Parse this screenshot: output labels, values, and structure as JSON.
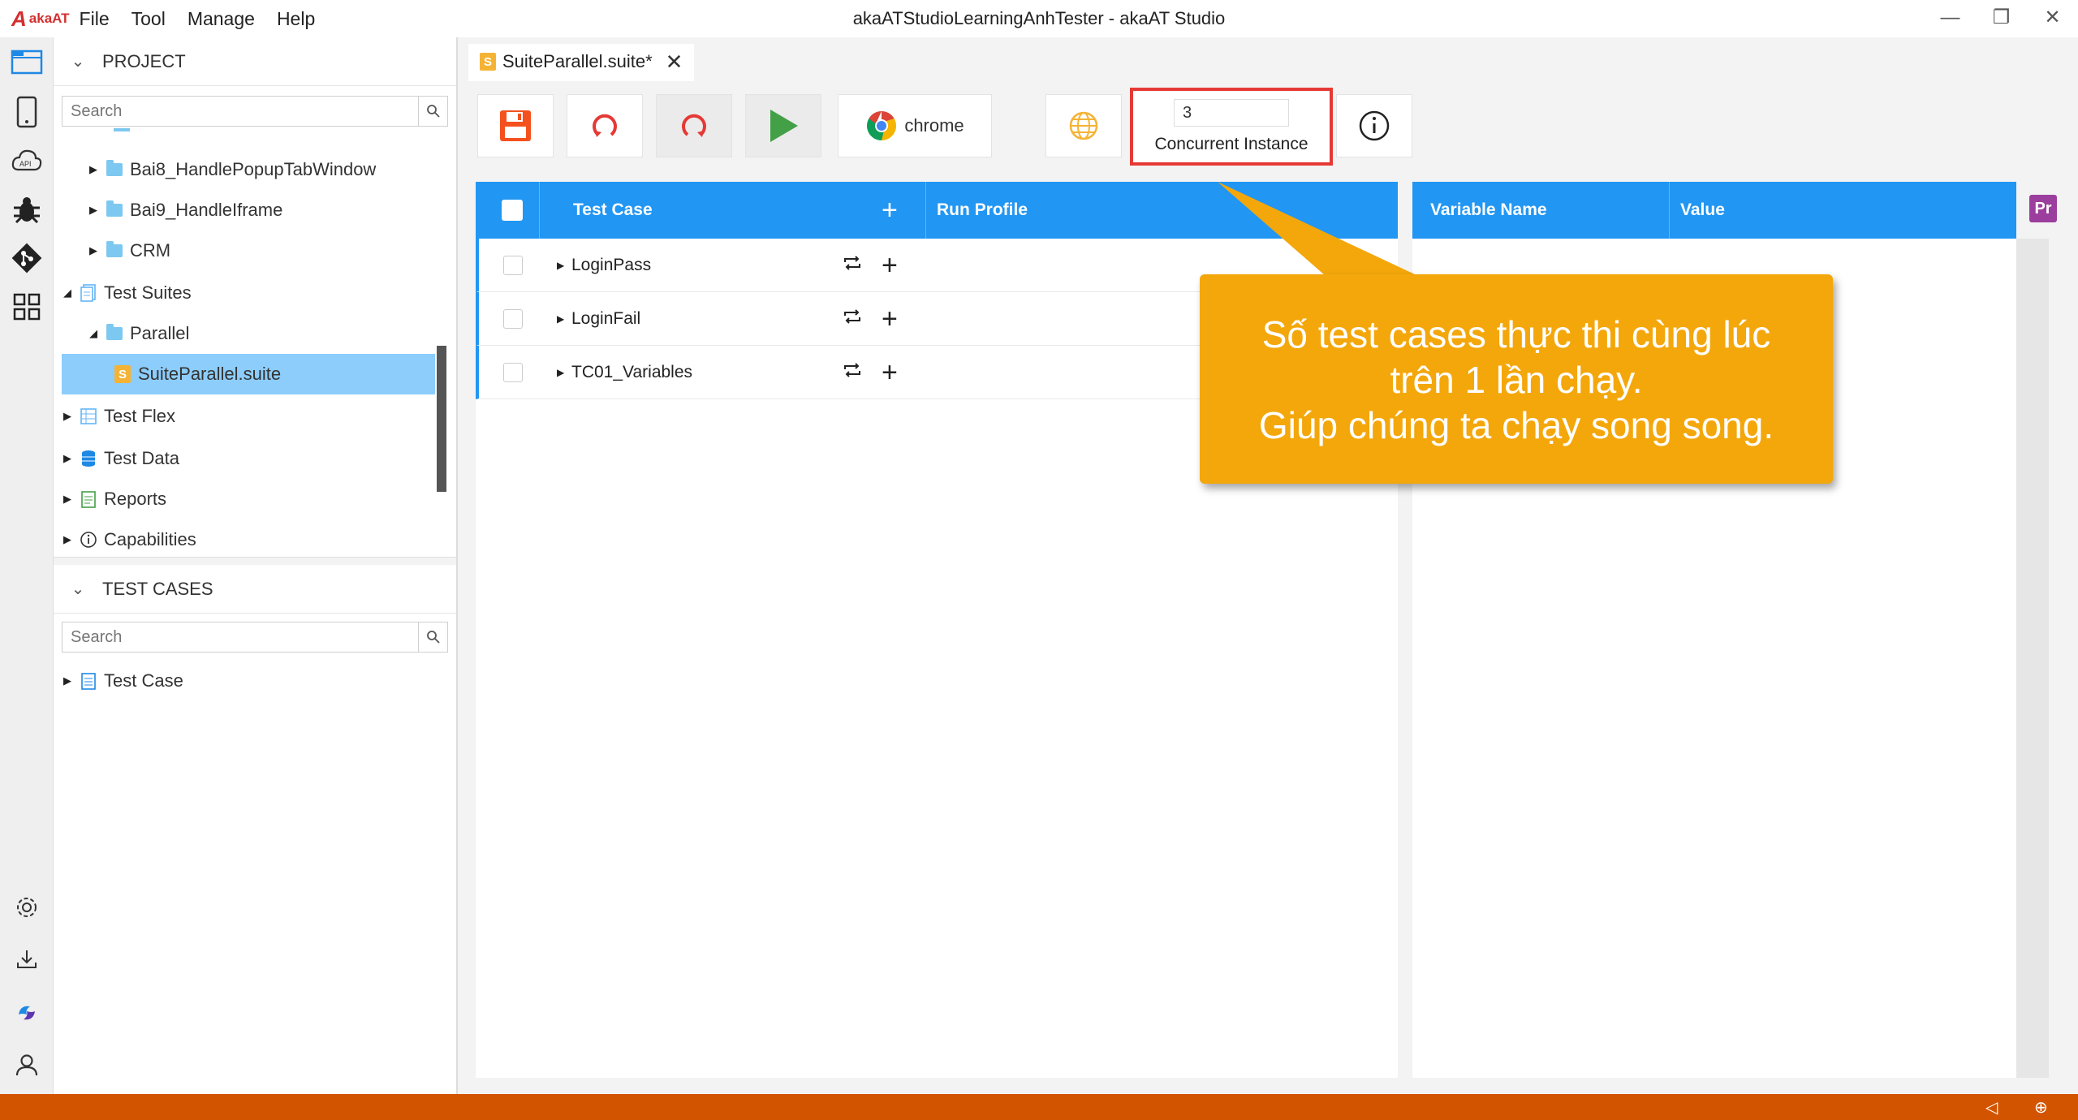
{
  "app": {
    "logo": "akaAT",
    "title": "akaATStudioLearningAnhTester - akaAT Studio",
    "menu": [
      "File",
      "Tool",
      "Manage",
      "Help"
    ]
  },
  "activity_bar": {
    "top_icons": [
      "folder-icon",
      "mobile-icon",
      "api-cloud-icon",
      "bug-icon",
      "git-icon",
      "grid-icon"
    ],
    "bottom_icons": [
      "settings-icon",
      "download-icon",
      "swirl-icon",
      "user-icon"
    ]
  },
  "project_panel": {
    "header": "PROJECT",
    "search_placeholder": "Search",
    "tree": [
      {
        "label": "Bai8_HandlePopupTabWindow",
        "type": "folder"
      },
      {
        "label": "Bai9_HandleIframe",
        "type": "folder"
      },
      {
        "label": "CRM",
        "type": "folder"
      },
      {
        "label": "Test Suites",
        "type": "suites"
      },
      {
        "label": "Parallel",
        "type": "folder"
      },
      {
        "label": "SuiteParallel.suite",
        "type": "suite-file"
      },
      {
        "label": "Test Flex",
        "type": "flex"
      },
      {
        "label": "Test Data",
        "type": "data"
      },
      {
        "label": "Reports",
        "type": "reports"
      },
      {
        "label": "Capabilities",
        "type": "capabilities"
      }
    ]
  },
  "test_cases_panel": {
    "header": "TEST CASES",
    "search_placeholder": "Search",
    "tree": [
      {
        "label": "Test Case"
      }
    ]
  },
  "editor": {
    "tab_label": "SuiteParallel.suite*",
    "tab_badge": "S",
    "toolbar": {
      "browser_label": "chrome",
      "concurrent_value": "3",
      "concurrent_label": "Concurrent Instance"
    },
    "left_grid": {
      "headers": {
        "test_case": "Test Case",
        "run_profile": "Run Profile"
      },
      "rows": [
        {
          "name": "LoginPass"
        },
        {
          "name": "LoginFail"
        },
        {
          "name": "TC01_Variables"
        }
      ]
    },
    "right_grid": {
      "headers": {
        "variable_name": "Variable Name",
        "value": "Value"
      },
      "badge": "Pr"
    }
  },
  "callout": {
    "line1": "Số test cases thực thi cùng lúc",
    "line2": "trên 1 lần chạy.",
    "line3": "Giúp chúng ta chạy song song.",
    "color": "#f4a70b"
  },
  "colors": {
    "accent": "#2196f3",
    "status_bar": "#d35400",
    "highlight_box": "#e53935",
    "selection": "#8ccdfc"
  }
}
